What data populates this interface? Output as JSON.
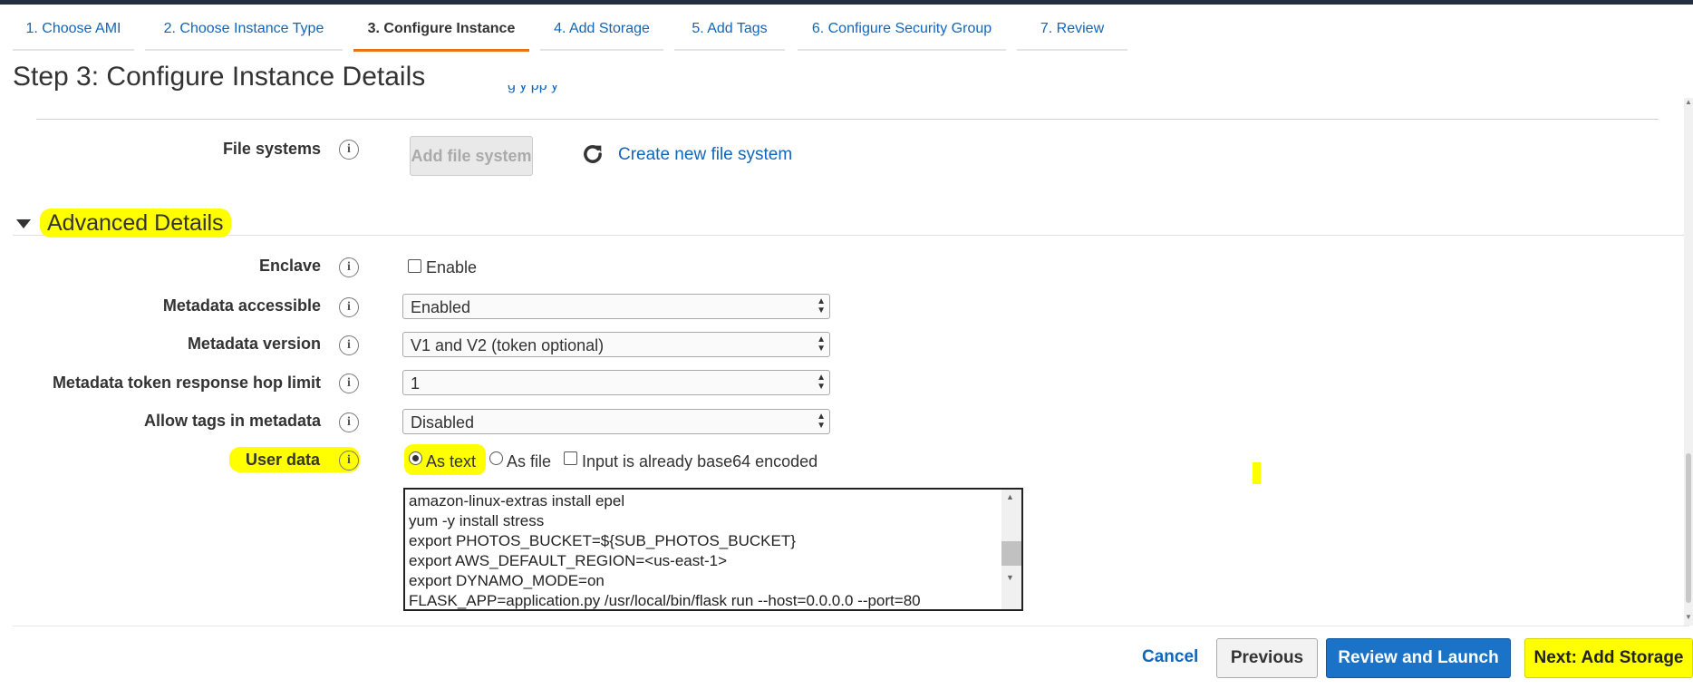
{
  "tabs": [
    {
      "label": "1. Choose AMI"
    },
    {
      "label": "2. Choose Instance Type"
    },
    {
      "label": "3. Configure Instance",
      "active": true
    },
    {
      "label": "4. Add Storage"
    },
    {
      "label": "5. Add Tags"
    },
    {
      "label": "6. Configure Security Group"
    },
    {
      "label": "7. Review"
    }
  ],
  "page_title": "Step 3: Configure Instance Details",
  "clipped_text": "g    y  pp y",
  "file_systems": {
    "label": "File systems",
    "add_button": "Add file system",
    "create_link": "Create new file system",
    "refresh_icon": "refresh-icon"
  },
  "advanced": {
    "title": "Advanced Details",
    "enclave": {
      "label": "Enclave",
      "checkbox_label": "Enable",
      "checked": false
    },
    "metadata_accessible": {
      "label": "Metadata accessible",
      "value": "Enabled"
    },
    "metadata_version": {
      "label": "Metadata version",
      "value": "V1 and V2 (token optional)"
    },
    "hop_limit": {
      "label": "Metadata token response hop limit",
      "value": "1"
    },
    "allow_tags": {
      "label": "Allow tags in metadata",
      "value": "Disabled"
    },
    "user_data": {
      "label": "User data",
      "as_text": "As text",
      "as_file": "As file",
      "base64": "Input is already base64 encoded",
      "selected": "As text",
      "lines": [
        "amazon-linux-extras install epel",
        "yum -y install stress",
        "export PHOTOS_BUCKET=${SUB_PHOTOS_BUCKET}",
        "export AWS_DEFAULT_REGION=<us-east-1>",
        "export DYNAMO_MODE=on",
        "FLASK_APP=application.py /usr/local/bin/flask run --host=0.0.0.0 --port=80"
      ]
    }
  },
  "footer": {
    "cancel": "Cancel",
    "previous": "Previous",
    "review_launch": "Review and Launch",
    "next": "Next: Add Storage"
  },
  "colors": {
    "link": "#1166bb",
    "active_tab_underline": "#ec7211",
    "primary_button": "#1a73c6",
    "highlight": "#ffff00"
  }
}
